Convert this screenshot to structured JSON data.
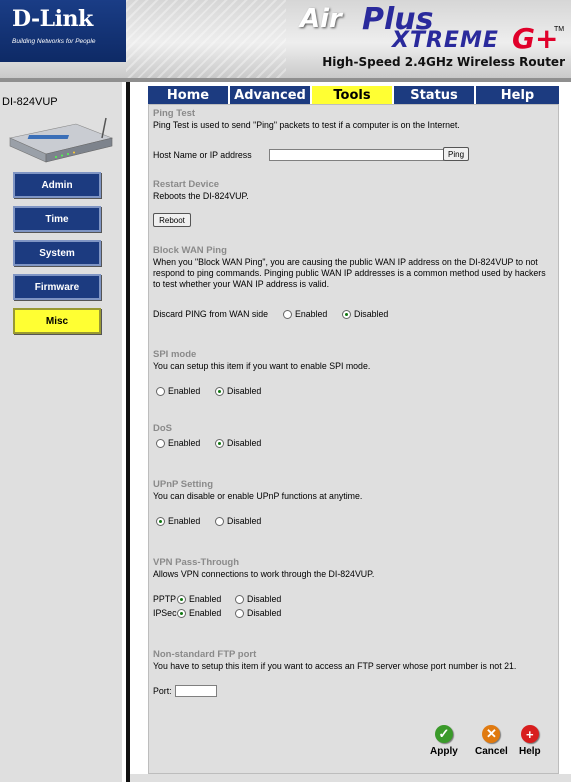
{
  "header": {
    "logo_text": "D-Link",
    "logo_tagline": "Building Networks for People",
    "brand_air": "Air",
    "brand_plus": "Plus",
    "brand_xtreme": "XTREME",
    "brand_gplus": "G+",
    "brand_tm": "TM",
    "subtitle": "High-Speed 2.4GHz Wireless Router"
  },
  "sidebar": {
    "model": "DI-824VUP",
    "buttons": [
      {
        "label": "Admin"
      },
      {
        "label": "Time"
      },
      {
        "label": "System"
      },
      {
        "label": "Firmware"
      },
      {
        "label": "Misc",
        "active": true
      }
    ]
  },
  "tabs": [
    {
      "label": "Home"
    },
    {
      "label": "Advanced"
    },
    {
      "label": "Tools",
      "active": true
    },
    {
      "label": "Status"
    },
    {
      "label": "Help"
    }
  ],
  "ping_test": {
    "title": "Ping Test",
    "desc": "Ping Test is used to send \"Ping\" packets to test if a computer is on the Internet.",
    "host_label": "Host Name or IP address",
    "host_value": "",
    "ping_button": "Ping"
  },
  "restart": {
    "title": "Restart Device",
    "desc": "Reboots the DI-824VUP.",
    "reboot_button": "Reboot"
  },
  "block_wan_ping": {
    "title": "Block WAN Ping",
    "desc": "When you \"Block WAN Ping\", you are causing the public WAN IP address on the DI-824VUP to not respond to ping commands. Pinging public WAN IP addresses is a common method used by hackers to test whether your WAN IP address is valid.",
    "label": "Discard PING from WAN side",
    "enabled": "Enabled",
    "disabled": "Disabled",
    "selected": "Disabled"
  },
  "spi": {
    "title": "SPI mode",
    "desc": "You can setup this item if you want to enable SPI mode.",
    "enabled": "Enabled",
    "disabled": "Disabled",
    "selected": "Disabled"
  },
  "dos": {
    "title": "DoS",
    "enabled": "Enabled",
    "disabled": "Disabled",
    "selected": "Disabled"
  },
  "upnp": {
    "title": "UPnP Setting",
    "desc": "You can disable or enable UPnP functions at anytime.",
    "enabled": "Enabled",
    "disabled": "Disabled",
    "selected": "Enabled"
  },
  "vpn": {
    "title": "VPN Pass-Through",
    "desc": "Allows VPN connections to work through the DI-824VUP.",
    "pptp_label": "PPTP",
    "pptp_selected": "Enabled",
    "ipsec_label": "IPSec",
    "ipsec_selected": "Enabled",
    "enabled": "Enabled",
    "disabled": "Disabled"
  },
  "ftp": {
    "title": "Non-standard FTP port",
    "desc": "You have to setup this item if you want to access an FTP server whose port number is not 21.",
    "port_label": "Port:",
    "port_value": ""
  },
  "actions": {
    "apply": "Apply",
    "cancel": "Cancel",
    "help": "Help"
  },
  "colors": {
    "nav_blue": "#1c3b80",
    "active_yellow": "#ffff33",
    "panel_gray": "#dfdfdf",
    "section_title_gray": "#8a8a8a",
    "apply_green": "#3a9a2a",
    "cancel_orange": "#e07a10",
    "help_red": "#d81e1e"
  }
}
